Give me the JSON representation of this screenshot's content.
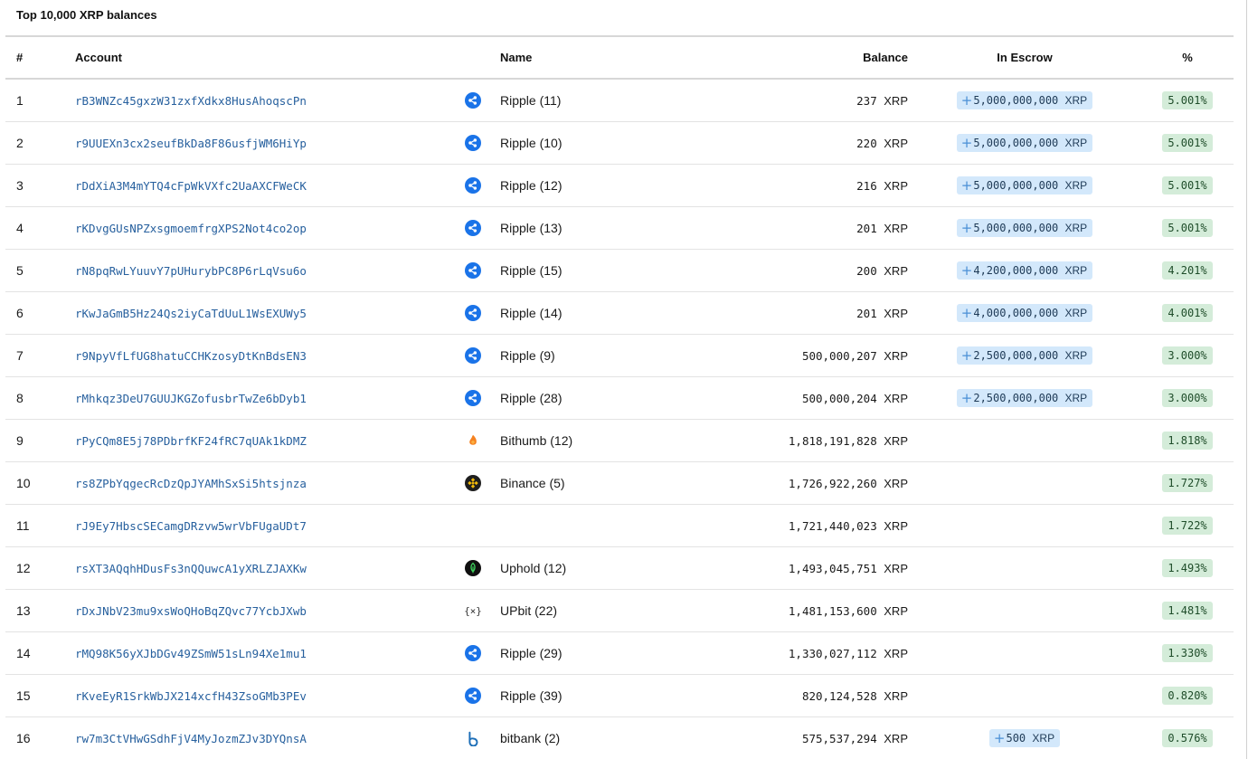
{
  "title": "Top 10,000 XRP balances",
  "headers": {
    "num": "#",
    "account": "Account",
    "name": "Name",
    "balance": "Balance",
    "escrow": "In Escrow",
    "pct": "%"
  },
  "unit": "XRP",
  "rows": [
    {
      "num": "1",
      "account": "rB3WNZc45gxzW31zxfXdkx8HusAhoqscPn",
      "logo": "ripple-icon",
      "name": "Ripple (11)",
      "balance": "237",
      "escrow": "5,000,000,000",
      "pct": "5.001%"
    },
    {
      "num": "2",
      "account": "r9UUEXn3cx2seufBkDa8F86usfjWM6HiYp",
      "logo": "ripple-icon",
      "name": "Ripple (10)",
      "balance": "220",
      "escrow": "5,000,000,000",
      "pct": "5.001%"
    },
    {
      "num": "3",
      "account": "rDdXiA3M4mYTQ4cFpWkVXfc2UaAXCFWeCK",
      "logo": "ripple-icon",
      "name": "Ripple (12)",
      "balance": "216",
      "escrow": "5,000,000,000",
      "pct": "5.001%"
    },
    {
      "num": "4",
      "account": "rKDvgGUsNPZxsgmoemfrgXPS2Not4co2op",
      "logo": "ripple-icon",
      "name": "Ripple (13)",
      "balance": "201",
      "escrow": "5,000,000,000",
      "pct": "5.001%"
    },
    {
      "num": "5",
      "account": "rN8pqRwLYuuvY7pUHurybPC8P6rLqVsu6o",
      "logo": "ripple-icon",
      "name": "Ripple (15)",
      "balance": "200",
      "escrow": "4,200,000,000",
      "pct": "4.201%"
    },
    {
      "num": "6",
      "account": "rKwJaGmB5Hz24Qs2iyCaTdUuL1WsEXUWy5",
      "logo": "ripple-icon",
      "name": "Ripple (14)",
      "balance": "201",
      "escrow": "4,000,000,000",
      "pct": "4.001%"
    },
    {
      "num": "7",
      "account": "r9NpyVfLfUG8hatuCCHKzosyDtKnBdsEN3",
      "logo": "ripple-icon",
      "name": "Ripple (9)",
      "balance": "500,000,207",
      "escrow": "2,500,000,000",
      "pct": "3.000%"
    },
    {
      "num": "8",
      "account": "rMhkqz3DeU7GUUJKGZofusbrTwZe6bDyb1",
      "logo": "ripple-icon",
      "name": "Ripple (28)",
      "balance": "500,000,204",
      "escrow": "2,500,000,000",
      "pct": "3.000%"
    },
    {
      "num": "9",
      "account": "rPyCQm8E5j78PDbrfKF24fRC7qUAk1kDMZ",
      "logo": "bithumb-icon",
      "name": "Bithumb (12)",
      "balance": "1,818,191,828",
      "escrow": "",
      "pct": "1.818%"
    },
    {
      "num": "10",
      "account": "rs8ZPbYqgecRcDzQpJYAMhSxSi5htsjnza",
      "logo": "binance-icon",
      "name": "Binance (5)",
      "balance": "1,726,922,260",
      "escrow": "",
      "pct": "1.727%"
    },
    {
      "num": "11",
      "account": "rJ9Ey7HbscSECamgDRzvw5wrVbFUgaUDt7",
      "logo": "",
      "name": "",
      "balance": "1,721,440,023",
      "escrow": "",
      "pct": "1.722%"
    },
    {
      "num": "12",
      "account": "rsXT3AQqhHDusFs3nQQuwcA1yXRLZJAXKw",
      "logo": "uphold-icon",
      "name": "Uphold (12)",
      "balance": "1,493,045,751",
      "escrow": "",
      "pct": "1.493%"
    },
    {
      "num": "13",
      "account": "rDxJNbV23mu9xsWoQHoBqZQvc77YcbJXwb",
      "logo": "upbit-icon",
      "name": "UPbit (22)",
      "balance": "1,481,153,600",
      "escrow": "",
      "pct": "1.481%"
    },
    {
      "num": "14",
      "account": "rMQ98K56yXJbDGv49ZSmW51sLn94Xe1mu1",
      "logo": "ripple-icon",
      "name": "Ripple (29)",
      "balance": "1,330,027,112",
      "escrow": "",
      "pct": "1.330%"
    },
    {
      "num": "15",
      "account": "rKveEyR1SrkWbJX214xcfH43ZsoGMb3PEv",
      "logo": "ripple-icon",
      "name": "Ripple (39)",
      "balance": "820,124,528",
      "escrow": "",
      "pct": "0.820%"
    },
    {
      "num": "16",
      "account": "rw7m3CtVHwGSdhFjV4MyJozmZJv3DYQnsA",
      "logo": "bitbank-icon",
      "name": "bitbank (2)",
      "balance": "575,537,294",
      "escrow": "500",
      "pct": "0.576%"
    }
  ],
  "colors": {
    "link": "#27609e",
    "escrow_bg": "#d3e8fb",
    "pct_bg": "#d4ecd9",
    "ripple": "#1a73e8"
  }
}
